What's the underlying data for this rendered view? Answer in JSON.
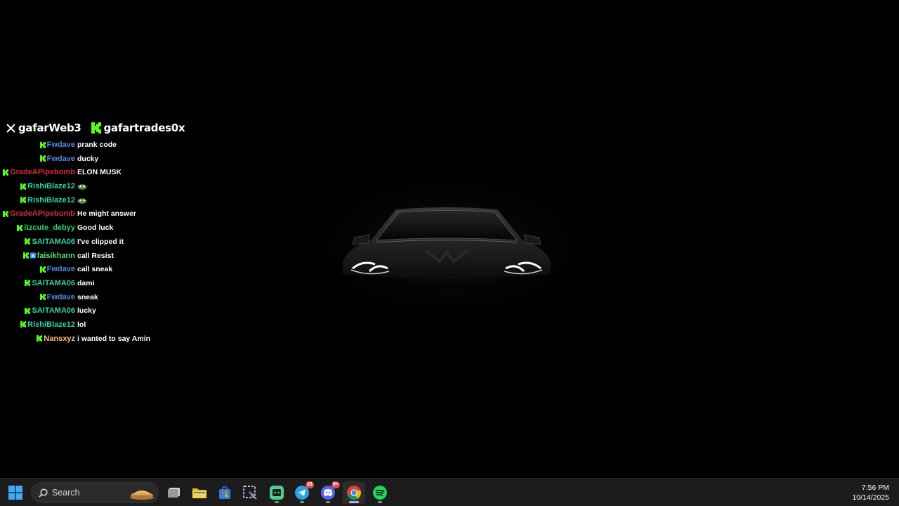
{
  "chat_overlay": {
    "header": {
      "x_handle": "gafarWeb3",
      "kick_handle": "gafartrades0x"
    },
    "messages": [
      {
        "user": "Fwdave",
        "color": "#4f8ae0",
        "text": "prank code"
      },
      {
        "user": "Fwdave",
        "color": "#4f8ae0",
        "text": "ducky"
      },
      {
        "user": "GradeAPipebomb",
        "color": "#d42a3a",
        "text": "ELON MUSK"
      },
      {
        "user": "RishiBlaze12",
        "color": "#33d6a8",
        "text": "",
        "emote": "frog-emote"
      },
      {
        "user": "RishiBlaze12",
        "color": "#33d6a8",
        "text": "",
        "emote": "frog-emote"
      },
      {
        "user": "GradeAPipebomb",
        "color": "#d42a3a",
        "text": "He might answer"
      },
      {
        "user": "itzcute_debyy",
        "color": "#2fd17a",
        "text": "Good luck"
      },
      {
        "user": "SAITAMA06",
        "color": "#33d6a8",
        "text": "I've clipped it"
      },
      {
        "user": "faisikhann",
        "color": "#5ee06a",
        "text": "call Resist",
        "extra_badge": true
      },
      {
        "user": "Fwdave",
        "color": "#4f8ae0",
        "text": "call sneak"
      },
      {
        "user": "SAITAMA06",
        "color": "#33d6a8",
        "text": "dami"
      },
      {
        "user": "Fwdave",
        "color": "#4f8ae0",
        "text": "sneak"
      },
      {
        "user": "SAITAMA06",
        "color": "#33d6a8",
        "text": "lucky"
      },
      {
        "user": "RishiBlaze12",
        "color": "#33d6a8",
        "text": "lol"
      },
      {
        "user": "Nansxyz",
        "color": "#f5c07a",
        "text": "i wanted to say Amin"
      }
    ]
  },
  "taskbar": {
    "search_label": "Search",
    "apps": [
      {
        "name": "task-view",
        "icon": "task-view-icon"
      },
      {
        "name": "file-explorer",
        "icon": "folder-icon"
      },
      {
        "name": "microsoft-store",
        "icon": "store-icon"
      },
      {
        "name": "snipping-tool",
        "icon": "snipping-tool-icon"
      },
      {
        "name": "app-green",
        "icon": "bot-icon"
      },
      {
        "name": "telegram",
        "icon": "telegram-icon",
        "badge": "28"
      },
      {
        "name": "discord",
        "icon": "discord-icon",
        "badge": "9+"
      },
      {
        "name": "chrome",
        "icon": "chrome-icon"
      },
      {
        "name": "spotify",
        "icon": "spotify-icon"
      }
    ],
    "clock_time": "7:56 PM",
    "clock_date": "10/14/2025"
  },
  "colors": {
    "kick_green": "#53fc18",
    "taskbar_bg": "#1c1c1c"
  }
}
